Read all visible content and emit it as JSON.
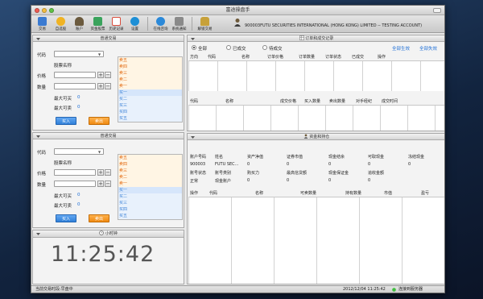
{
  "window": {
    "title": "富途操盘手"
  },
  "toolbar": {
    "buttons": [
      {
        "label": "交易",
        "icon": "trade-icon",
        "color": "#3a7ad1"
      },
      {
        "label": "自选股",
        "icon": "watchlist-icon",
        "color": "#f0b323"
      },
      {
        "label": "账户",
        "icon": "account-icon",
        "color": "#6b5a3e"
      },
      {
        "label": "资金股票",
        "icon": "funds-icon",
        "color": "#3aa35c"
      },
      {
        "label": "历史记录",
        "icon": "history-icon",
        "color": "#d84c3b"
      },
      {
        "label": "设置",
        "icon": "settings-icon",
        "color": "#1d8fd6"
      },
      {
        "label": "在线咨询",
        "icon": "chat-icon",
        "color": "#2b89d9"
      },
      {
        "label": "系统通知",
        "icon": "notify-icon",
        "color": "#6b6b6b"
      },
      {
        "label": "解锁交易",
        "icon": "unlock-icon",
        "color": "#c7a13a"
      }
    ],
    "account": "900003FUTU SECURITIES INTERNATIONAL (HONG KONG) LIMITED -- TESTING ACCOUNT)"
  },
  "trade_panels": [
    {
      "title": "普通交易",
      "code_label": "代码",
      "name_label": "股票名称",
      "price_label": "价格",
      "qty_label": "数量",
      "max_buy_label": "最大可买",
      "max_buy": "0",
      "max_sell_label": "最大可卖",
      "max_sell": "0",
      "buy_label": "买入",
      "sell_label": "卖出",
      "asks": [
        "卖五",
        "卖四",
        "卖三",
        "卖二",
        "卖一"
      ],
      "bids": [
        "买一",
        "买二",
        "买三",
        "买四",
        "买五"
      ]
    },
    {
      "title": "普通交易",
      "code_label": "代码",
      "name_label": "股票名称",
      "price_label": "价格",
      "qty_label": "数量",
      "max_buy_label": "最大可买",
      "max_buy": "0",
      "max_sell_label": "最大可卖",
      "max_sell": "0",
      "buy_label": "买入",
      "sell_label": "卖出",
      "asks": [
        "卖五",
        "卖四",
        "卖三",
        "卖二",
        "卖一"
      ],
      "bids": [
        "买一",
        "买二",
        "买三",
        "买四",
        "买五"
      ]
    }
  ],
  "clock_panel": {
    "title": "小时钟",
    "time": "11:25:42"
  },
  "status_bar": {
    "session": "当前交易时段:早盘中",
    "datetime": "2012/12/04 11:25:42",
    "connection": "连接到服务器",
    "connection_color": "#3fbf3f"
  },
  "orders_panel": {
    "title": "订单和成交记录",
    "filters": [
      "全部",
      "已成交",
      "待成交"
    ],
    "selected_filter": 0,
    "actions": [
      "全部生效",
      "全部失效"
    ],
    "order_columns": [
      "方向",
      "代码",
      "名称",
      "订单价格",
      "订单数量",
      "订单状态",
      "已成交",
      "操作"
    ],
    "deal_columns": [
      "代码",
      "名称",
      "成交价格",
      "买入数量",
      "卖出数量",
      "对手经纪",
      "成交时间"
    ]
  },
  "funds_panel": {
    "title": "资金和持仓",
    "summary_headers": [
      "账户号码",
      "姓名",
      "资产净值",
      "证券市值",
      "现金结余",
      "可取现金",
      "冻结现金"
    ],
    "summary_values": [
      "900003",
      "FUTU SEC...",
      "0",
      "0",
      "0",
      "0",
      "0"
    ],
    "summary2_headers": [
      "账号状态",
      "账号类别",
      "购买力",
      "最高信贷额",
      "现金保证金",
      "追收金额"
    ],
    "summary2_values": [
      "正常",
      "现金账户",
      "0",
      "0",
      "0",
      "0"
    ],
    "position_columns": [
      "操作",
      "代码",
      "名称",
      "可卖数量",
      "持有数量",
      "市值",
      "盈亏"
    ]
  }
}
